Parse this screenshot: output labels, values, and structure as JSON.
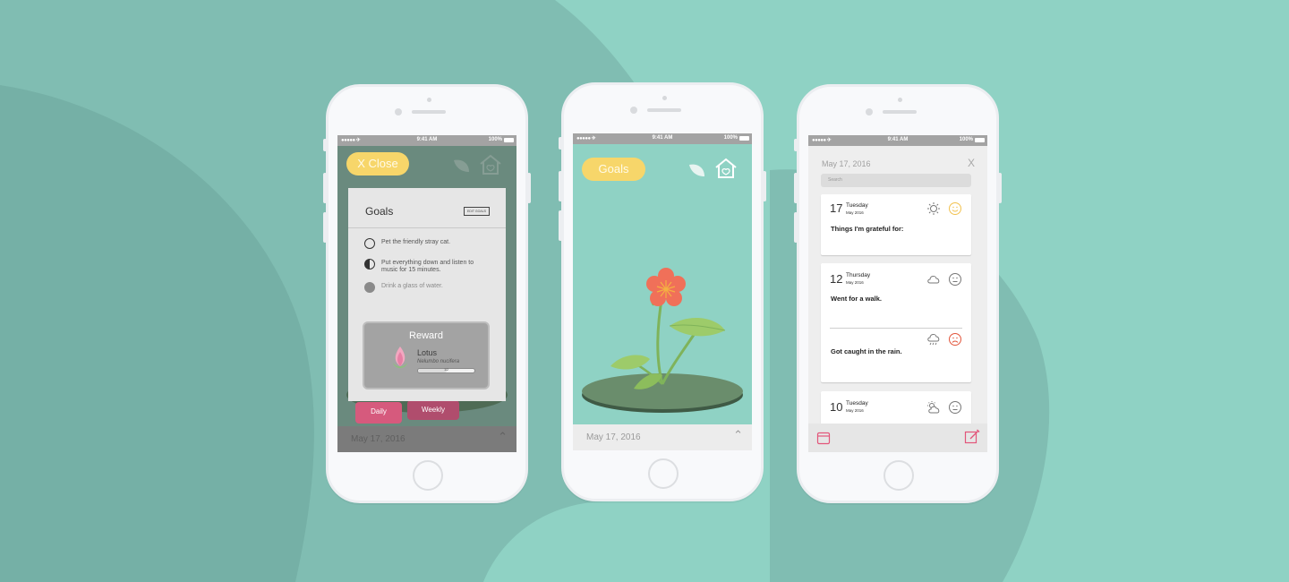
{
  "colors": {
    "background": "#8fd2c4",
    "background_dark": "#7cb8ae",
    "goals_pill": "#f7d66a",
    "daily_tab": "#d65a7d",
    "weekly_tab": "#b04d6d",
    "statusbar": "#a3a3a3",
    "flower": "#f07059",
    "leaf": "#9dcb6a",
    "lilypad": "#6a8d6c"
  },
  "status_bar": {
    "signal": "●●●●● ✈",
    "time": "9:41 AM",
    "battery": "100%"
  },
  "phone_goals_modal": {
    "close_label": "X Close",
    "modal_title": "Goals",
    "edit_goals_label": "EDIT GOALS",
    "goals": [
      {
        "text": "Pet the friendly stray cat.",
        "state": "empty"
      },
      {
        "text": "Put everything down and listen to music for 15 minutes.",
        "state": "half"
      },
      {
        "text": "Drink a glass of water.",
        "state": "done"
      }
    ],
    "reward": {
      "title": "Reward",
      "name": "Lotus",
      "scientific_name": "Nelumbo nucifera",
      "progress_text": "1/2",
      "progress": 0.5
    },
    "tabs": {
      "daily": "Daily",
      "weekly": "Weekly"
    },
    "date": "May 17, 2016"
  },
  "phone_garden": {
    "goals_label": "Goals",
    "date": "May 17, 2016"
  },
  "phone_journal": {
    "date": "May 17, 2016",
    "close_label": "X",
    "search_placeholder": "Search",
    "entries": [
      {
        "day": "17",
        "weekday": "Tuesday",
        "month_year": "May 2016",
        "notes": [
          "Things I'm grateful for:"
        ],
        "weather": "sun-icon",
        "mood": "happy-face-icon"
      },
      {
        "day": "12",
        "weekday": "Thursday",
        "month_year": "May 2016",
        "notes": [
          "Went for a walk.",
          "Got caught in the rain."
        ],
        "weather": "cloud-icon",
        "mood": "neutral-face-icon"
      },
      {
        "day": "10",
        "weekday": "Tuesday",
        "month_year": "May 2016",
        "notes": [],
        "weather": "partly-cloudy-icon",
        "mood": "neutral-face-icon"
      }
    ]
  }
}
